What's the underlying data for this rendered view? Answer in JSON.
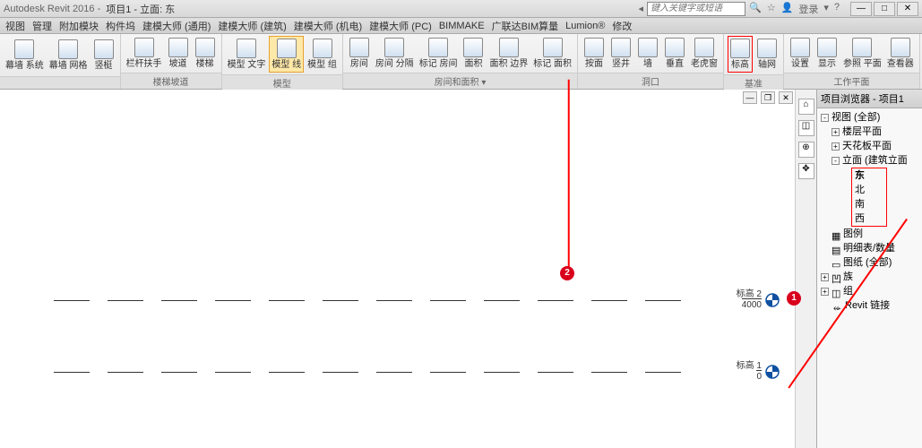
{
  "titlebar": {
    "app": "Autodesk Revit 2016 -",
    "doc": "项目1 - 立面: 东",
    "search_placeholder": "键入关键字或短语",
    "login": "登录"
  },
  "menu": [
    "视图",
    "管理",
    "附加模块",
    "构件坞",
    "建模大师 (通用)",
    "建模大师 (建筑)",
    "建模大师 (机电)",
    "建模大师 (PC)",
    "BIMMAKE",
    "广联达BIM算量",
    "Lumion®",
    "修改"
  ],
  "ribbon": {
    "g1": {
      "label": "",
      "items": [
        {
          "l": "幕墙\n系统"
        },
        {
          "l": "幕墙\n网格"
        },
        {
          "l": "竖梃"
        }
      ]
    },
    "g2": {
      "label": "",
      "items": [
        {
          "l": "栏杆扶手"
        },
        {
          "l": "坡道"
        },
        {
          "l": "楼梯"
        }
      ]
    },
    "g2_label": "楼梯坡道",
    "g3": {
      "label": "模型",
      "items": [
        {
          "l": "模型\n文字"
        },
        {
          "l": "模型\n线",
          "active": true
        },
        {
          "l": "模型\n组"
        }
      ]
    },
    "g4": {
      "label": "房间和面积 ▾",
      "items": [
        {
          "l": "房间"
        },
        {
          "l": "房间\n分隔"
        },
        {
          "l": "标记\n房间"
        },
        {
          "l": "面积"
        },
        {
          "l": "面积\n边界"
        },
        {
          "l": "标记\n面积"
        }
      ]
    },
    "g5": {
      "label": "洞口",
      "items": [
        {
          "l": "按面"
        },
        {
          "l": "竖井"
        },
        {
          "l": "墙"
        },
        {
          "l": "垂直"
        },
        {
          "l": "老虎窗"
        }
      ]
    },
    "g6": {
      "label": "基准",
      "items": [
        {
          "l": "标高",
          "highlight": true
        },
        {
          "l": "轴网"
        }
      ]
    },
    "g7": {
      "label": "工作平面",
      "items": [
        {
          "l": "设置"
        },
        {
          "l": "显示"
        },
        {
          "l": "参照\n平面"
        },
        {
          "l": "查看器"
        }
      ]
    }
  },
  "levels": [
    {
      "name": "标高 2",
      "value": "4000"
    },
    {
      "name": "标高 1",
      "value": "0"
    }
  ],
  "browser": {
    "title": "项目浏览器 - 项目1",
    "root": "视图 (全部)",
    "floor": "楼层平面",
    "ceiling": "天花板平面",
    "elev": "立面 (建筑立面",
    "dirs": [
      "东",
      "北",
      "南",
      "西"
    ],
    "legend": "图例",
    "schedule": "明细表/数量",
    "sheets": "图纸 (全部)",
    "families": "族",
    "groups": "组",
    "links": "Revit 链接"
  },
  "annotations": {
    "b1": "1",
    "b2": "2"
  }
}
